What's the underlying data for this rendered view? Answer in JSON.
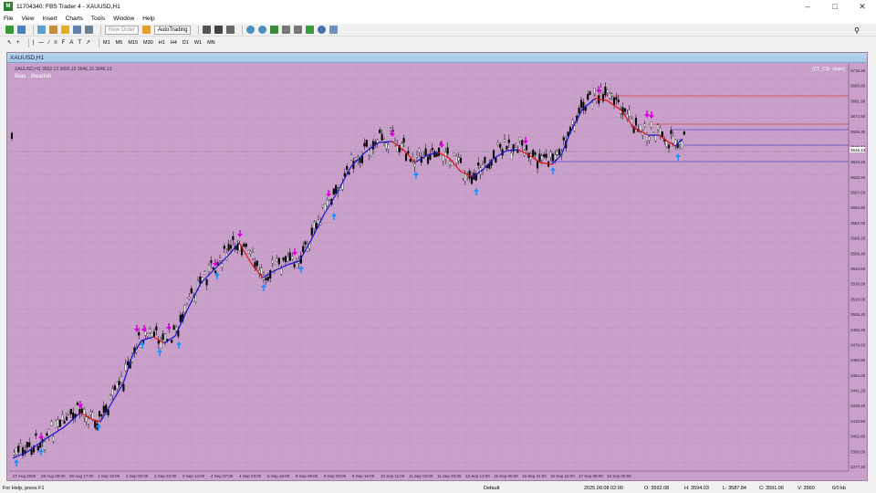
{
  "window": {
    "title": "11704340: FBS Trader 4 - XAUUSD,H1"
  },
  "menu": [
    "File",
    "View",
    "Insert",
    "Charts",
    "Tools",
    "Window",
    "Help"
  ],
  "toolbar": {
    "new_order": "New Order",
    "auto_trading": "AutoTrading"
  },
  "timeframes": [
    "M1",
    "M5",
    "M15",
    "M30",
    "H1",
    "H4",
    "D1",
    "W1",
    "MN"
  ],
  "chart": {
    "window_title": "XAUUSD,H1",
    "info_line": "XAUUSD,H1  3652.13 3656.15 3646.15 3646.13",
    "bias_label": "Bias : Bearish",
    "indicator_label": "(CT_CSI: slope)",
    "price_labels": [
      "3719.20",
      "3695.80",
      "3681.90",
      "3672.60",
      "3659.30",
      "3646.13",
      "3633.20",
      "3620.40",
      "3607.60",
      "3594.80",
      "3582.00",
      "3569.20",
      "3556.40",
      "3543.60",
      "3530.80",
      "3518.00",
      "3505.20",
      "3492.40",
      "3479.60",
      "3466.80",
      "3454.00",
      "3441.20",
      "3428.40",
      "3415.60",
      "3402.80",
      "3390.00",
      "3377.20"
    ],
    "highlight_price": "3646.13",
    "time_labels": [
      "27 Aug 2025",
      "28 Aug 09:00",
      "29 Aug 17:00",
      "1 Sep 16:00",
      "2 Sep 00:00",
      "2 Sep 23:00",
      "3 Sep 14:00",
      "4 Sep 07:00",
      "4 Sep 23:00",
      "5 Sep 16:00",
      "8 Sep 08:00",
      "9 Sep 00:00",
      "9 Sep 16:00",
      "10 Sep 11:00",
      "11 Sep 04:00",
      "11 Sep 20:00",
      "12 Sep 13:00",
      "15 Sep 05:00",
      "15 Sep 21:00",
      "16 Sep 15:00",
      "17 Sep 08:00",
      "18 Sep 00:00"
    ],
    "colors": {
      "background": "#c9a0c9",
      "grid": "#a981a9",
      "bull_line": "#1616c8",
      "bear_line": "#e01010",
      "sell_arrow": "#e000e0",
      "buy_arrow": "#1e90ff",
      "candle": "#000000"
    }
  },
  "status": {
    "help": "For Help, press F1",
    "profile": "Default",
    "datetime": "2025.09.08 02:00",
    "open": "O: 3592.08",
    "high": "H: 3594.03",
    "low": "L: 3587.84",
    "close": "C: 3591.06",
    "volume": "V: 3560",
    "traffic": "6/0 kb"
  }
}
